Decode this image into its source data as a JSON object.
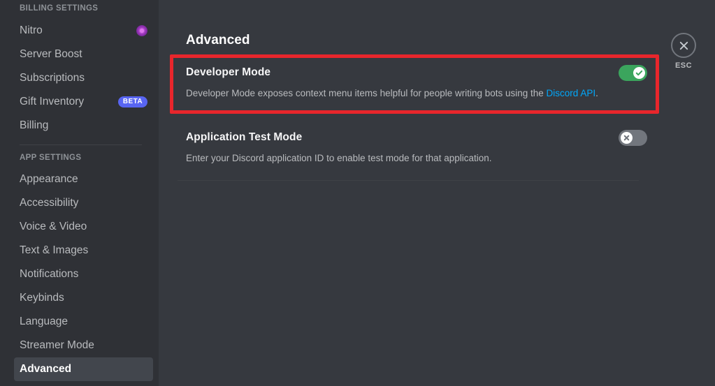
{
  "sidebar": {
    "sections": [
      {
        "header": "BILLING SETTINGS",
        "items": [
          {
            "label": "Nitro",
            "badge": "nitro-icon",
            "active": false
          },
          {
            "label": "Server Boost",
            "badge": null,
            "active": false
          },
          {
            "label": "Subscriptions",
            "badge": null,
            "active": false
          },
          {
            "label": "Gift Inventory",
            "badge": "BETA",
            "active": false
          },
          {
            "label": "Billing",
            "badge": null,
            "active": false
          }
        ]
      },
      {
        "header": "APP SETTINGS",
        "items": [
          {
            "label": "Appearance",
            "badge": null,
            "active": false
          },
          {
            "label": "Accessibility",
            "badge": null,
            "active": false
          },
          {
            "label": "Voice & Video",
            "badge": null,
            "active": false
          },
          {
            "label": "Text & Images",
            "badge": null,
            "active": false
          },
          {
            "label": "Notifications",
            "badge": null,
            "active": false
          },
          {
            "label": "Keybinds",
            "badge": null,
            "active": false
          },
          {
            "label": "Language",
            "badge": null,
            "active": false
          },
          {
            "label": "Streamer Mode",
            "badge": null,
            "active": false
          },
          {
            "label": "Advanced",
            "badge": null,
            "active": true
          }
        ]
      }
    ]
  },
  "main": {
    "title": "Advanced",
    "settings": [
      {
        "name": "developer-mode",
        "title": "Developer Mode",
        "description_before": "Developer Mode exposes context menu items helpful for people writing bots using the ",
        "link_text": "Discord API",
        "description_after": ".",
        "toggle_state": "on",
        "highlighted": true
      },
      {
        "name": "application-test-mode",
        "title": "Application Test Mode",
        "description_before": "Enter your Discord application ID to enable test mode for that application.",
        "link_text": "",
        "description_after": "",
        "toggle_state": "off",
        "highlighted": false
      }
    ]
  },
  "close": {
    "label": "ESC",
    "icon": "close-icon"
  },
  "colors": {
    "sidebar_bg": "#2f3136",
    "main_bg": "#36393f",
    "active_item_bg": "#42464d",
    "toggle_on": "#3ba55d",
    "toggle_off": "#72767d",
    "link": "#00a8fc",
    "highlight_border": "#e8262c",
    "beta_badge": "#5865f2"
  }
}
